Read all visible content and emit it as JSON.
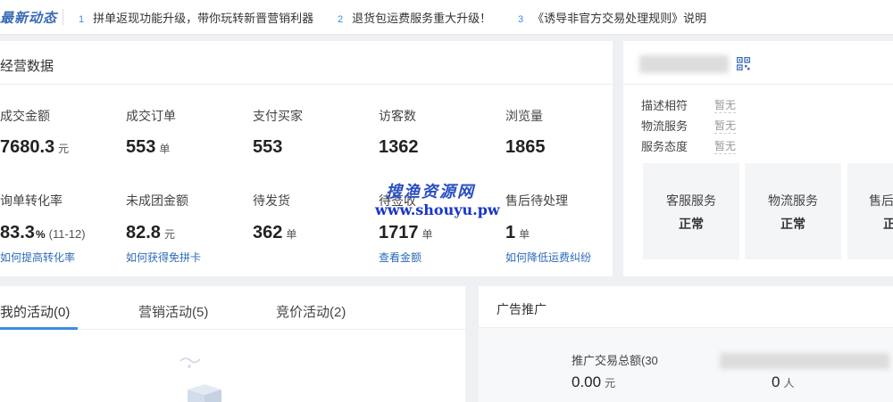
{
  "news": {
    "title": "最新动态",
    "items": [
      {
        "num": "1",
        "text": "拼单返现功能升级，带你玩转新晋营销利器"
      },
      {
        "num": "2",
        "text": "退货包运费服务重大升级！"
      },
      {
        "num": "3",
        "text": "《诱导非官方交易处理规则》说明"
      }
    ]
  },
  "business": {
    "title": "经营数据",
    "row1": [
      {
        "label": "成交金额",
        "value": "7680.3",
        "unit": "元"
      },
      {
        "label": "成交订单",
        "value": "553",
        "unit": "单"
      },
      {
        "label": "支付买家",
        "value": "553",
        "unit": ""
      },
      {
        "label": "访客数",
        "value": "1362",
        "unit": ""
      },
      {
        "label": "浏览量",
        "value": "1865",
        "unit": ""
      }
    ],
    "row2": [
      {
        "label": "询单转化率",
        "value": "83.3",
        "unit": "%",
        "extra": "(11-12)",
        "link": "如何提高转化率"
      },
      {
        "label": "未成团金额",
        "value": "82.8",
        "unit": "元",
        "link": "如何获得免拼卡"
      },
      {
        "label": "待发货",
        "value": "362",
        "unit": "单"
      },
      {
        "label": "待签收",
        "value": "1717",
        "unit": "单",
        "link": "查看金额"
      },
      {
        "label": "售后待处理",
        "value": "1",
        "unit": "单",
        "link": "如何降低运费纠纷"
      }
    ]
  },
  "store": {
    "ratings": [
      {
        "label": "描述相符",
        "value": "暂无"
      },
      {
        "label": "物流服务",
        "value": "暂无"
      },
      {
        "label": "服务态度",
        "value": "暂无"
      }
    ],
    "services": [
      {
        "name": "客服服务",
        "status": "正常"
      },
      {
        "name": "物流服务",
        "status": "正常"
      },
      {
        "name": "售后",
        "status": "正"
      }
    ]
  },
  "activities": {
    "tabs": [
      {
        "label": "我的活动(0)",
        "active": true
      },
      {
        "label": "营销活动(5)",
        "active": false
      },
      {
        "label": "竞价活动(2)",
        "active": false
      }
    ]
  },
  "ads": {
    "title": "广告推广",
    "total_label": "推广交易总额(30",
    "total_value": "0.00",
    "total_unit": "元",
    "people_value": "0",
    "people_unit": "人"
  },
  "watermark": {
    "line1": "搜渔资源网",
    "line2": "www.shouyu.pw"
  },
  "colors": {
    "link": "#2d6bb8",
    "accent_tab": "#3a8ee6",
    "background": "#eef0f3"
  }
}
